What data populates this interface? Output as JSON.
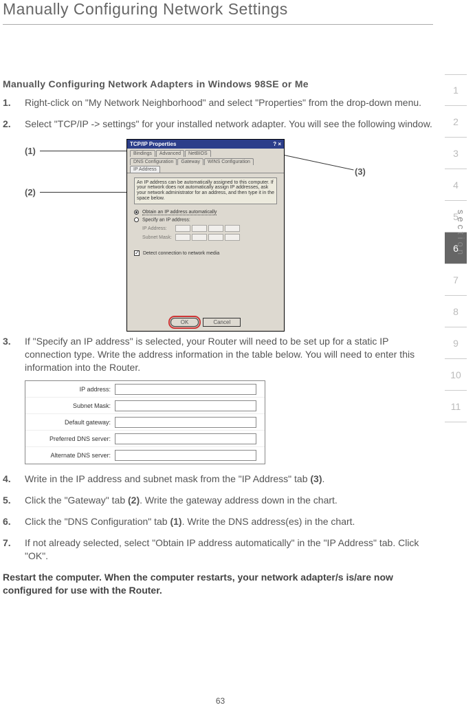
{
  "page_title": "Manually Configuring Network Settings",
  "subhead": "Manually Configuring Network Adapters in Windows 98SE or Me",
  "steps": {
    "s1": "Right-click on \"My Network Neighborhood\" and select \"Properties\" from the drop-down menu.",
    "s2": "Select \"TCP/IP -> settings\" for your installed network adapter. You will see the following window.",
    "s3": "If \"Specify an IP address\" is selected, your Router will need to be set up for a static IP connection type. Write the address information in the table below. You will need to enter this information into the Router.",
    "s4_a": "Write in the IP address and subnet mask from the \"IP Address\" tab ",
    "s4_b": "(3)",
    "s4_c": ".",
    "s5_a": "Click the \"Gateway\" tab ",
    "s5_b": "(2)",
    "s5_c": ". Write the gateway address down in the chart.",
    "s6_a": "Click the \"DNS Configuration\" tab ",
    "s6_b": "(1)",
    "s6_c": ". Write the DNS address(es) in the chart.",
    "s7": "If not already selected, select \"Obtain IP address automatically\" in the \"IP Address\" tab. Click \"OK\"."
  },
  "callouts": {
    "c1": "(1)",
    "c2": "(2)",
    "c3": "(3)"
  },
  "dialog": {
    "title": "TCP/IP Properties",
    "tabs_row1": [
      "Bindings",
      "Advanced",
      "NetBIOS"
    ],
    "tabs_row2": [
      "DNS Configuration",
      "Gateway",
      "WINS Configuration",
      "IP Address"
    ],
    "info": "An IP address can be automatically assigned to this computer. If your network does not automatically assign IP addresses, ask your network administrator for an address, and then type it in the space below.",
    "radio1": "Obtain an IP address automatically",
    "radio2": "Specify an IP address:",
    "ip_label": "IP Address:",
    "subnet_label": "Subnet Mask:",
    "detect": "Detect connection to network media",
    "ok": "OK",
    "cancel": "Cancel"
  },
  "table": {
    "r1": "IP address:",
    "r2": "Subnet Mask:",
    "r3": "Default gateway:",
    "r4": "Preferred DNS server:",
    "r5": "Alternate DNS server:"
  },
  "closing": "Restart the computer. When the computer restarts, your network adapter/s is/are now configured for use with the Router.",
  "page_no": "63",
  "sidenav": {
    "label": "section",
    "items": [
      "1",
      "2",
      "3",
      "4",
      "5",
      "6",
      "7",
      "8",
      "9",
      "10",
      "11"
    ],
    "active": "6"
  }
}
